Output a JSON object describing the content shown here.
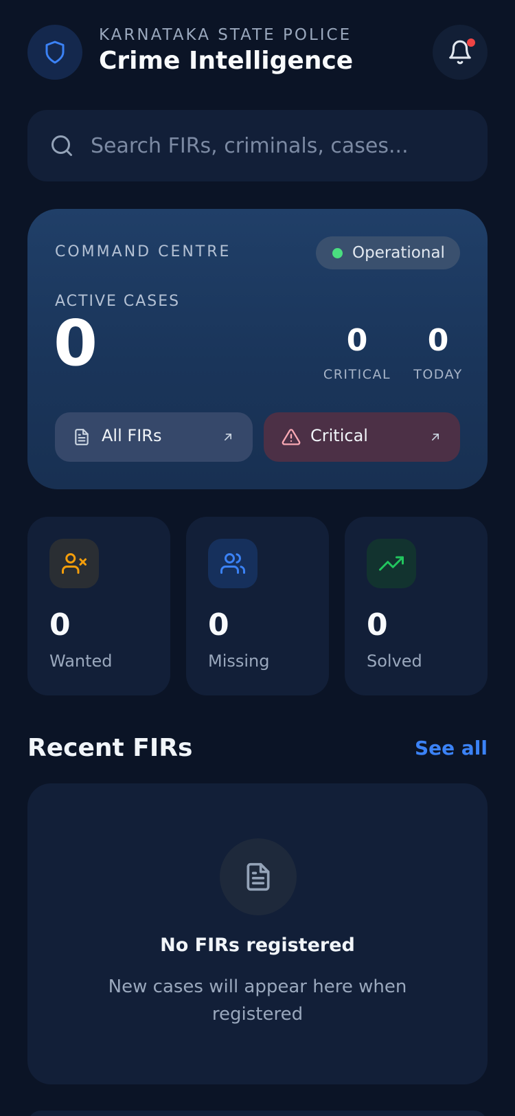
{
  "header": {
    "eyebrow": "KARNATAKA STATE POLICE",
    "title": "Crime Intelligence",
    "notification_dot": true
  },
  "search": {
    "placeholder": "Search FIRs, criminals, cases..."
  },
  "command_centre": {
    "label": "COMMAND CENTRE",
    "status": "Operational",
    "status_color": "#4ade80",
    "active_label": "ACTIVE CASES",
    "active_value": "0",
    "critical_value": "0",
    "critical_label": "CRITICAL",
    "today_value": "0",
    "today_label": "TODAY",
    "buttons": {
      "all_firs": "All FIRs",
      "critical": "Critical"
    }
  },
  "stats": [
    {
      "value": "0",
      "label": "Wanted",
      "icon": "user-x-icon",
      "color": "#f59e0b"
    },
    {
      "value": "0",
      "label": "Missing",
      "icon": "users-icon",
      "color": "#3b82f6"
    },
    {
      "value": "0",
      "label": "Solved",
      "icon": "trending-up-icon",
      "color": "#22c55e"
    }
  ],
  "recent": {
    "title": "Recent FIRs",
    "see_all": "See all",
    "empty_title": "No FIRs registered",
    "empty_subtitle": "New cases will appear here when registered"
  },
  "colors": {
    "background": "#0b1426",
    "card": "#121f38",
    "accent": "#3b82f6",
    "alert": "#ef4444"
  }
}
